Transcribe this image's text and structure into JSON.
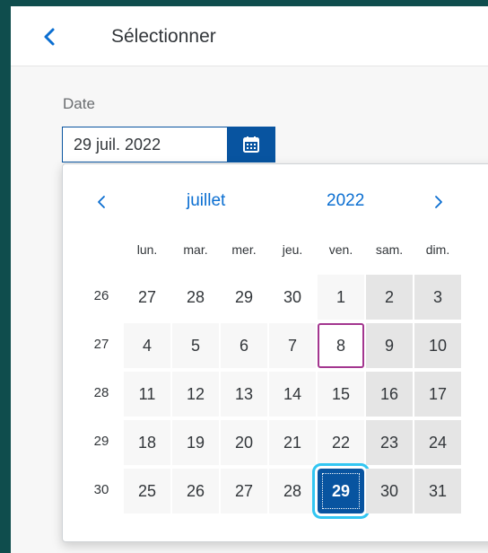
{
  "header": {
    "title": "Sélectionner",
    "back_icon": "chevron-left-icon"
  },
  "field": {
    "label": "Date",
    "value": "29 juil. 2022",
    "button_icon": "calendar-icon"
  },
  "calendar": {
    "month": "juillet",
    "year": "2022",
    "weekdays": [
      "lun.",
      "mar.",
      "mer.",
      "jeu.",
      "ven.",
      "sam.",
      "dim."
    ],
    "weeks": [
      {
        "number": "26",
        "days": [
          {
            "d": "27",
            "t": "other"
          },
          {
            "d": "28",
            "t": "other"
          },
          {
            "d": "29",
            "t": "other"
          },
          {
            "d": "30",
            "t": "other"
          },
          {
            "d": "1",
            "t": "cur"
          },
          {
            "d": "2",
            "t": "weekend"
          },
          {
            "d": "3",
            "t": "weekend"
          }
        ]
      },
      {
        "number": "27",
        "days": [
          {
            "d": "4",
            "t": "cur"
          },
          {
            "d": "5",
            "t": "cur"
          },
          {
            "d": "6",
            "t": "cur"
          },
          {
            "d": "7",
            "t": "cur"
          },
          {
            "d": "8",
            "t": "today"
          },
          {
            "d": "9",
            "t": "weekend"
          },
          {
            "d": "10",
            "t": "weekend"
          }
        ]
      },
      {
        "number": "28",
        "days": [
          {
            "d": "11",
            "t": "cur"
          },
          {
            "d": "12",
            "t": "cur"
          },
          {
            "d": "13",
            "t": "cur"
          },
          {
            "d": "14",
            "t": "cur"
          },
          {
            "d": "15",
            "t": "cur"
          },
          {
            "d": "16",
            "t": "weekend"
          },
          {
            "d": "17",
            "t": "weekend"
          }
        ]
      },
      {
        "number": "29",
        "days": [
          {
            "d": "18",
            "t": "cur"
          },
          {
            "d": "19",
            "t": "cur"
          },
          {
            "d": "20",
            "t": "cur"
          },
          {
            "d": "21",
            "t": "cur"
          },
          {
            "d": "22",
            "t": "cur"
          },
          {
            "d": "23",
            "t": "weekend"
          },
          {
            "d": "24",
            "t": "weekend"
          }
        ]
      },
      {
        "number": "30",
        "days": [
          {
            "d": "25",
            "t": "cur"
          },
          {
            "d": "26",
            "t": "cur"
          },
          {
            "d": "27",
            "t": "cur"
          },
          {
            "d": "28",
            "t": "cur"
          },
          {
            "d": "29",
            "t": "sel"
          },
          {
            "d": "30",
            "t": "weekend"
          },
          {
            "d": "31",
            "t": "weekend"
          }
        ]
      }
    ]
  },
  "colors": {
    "accent": "#0854a0",
    "link": "#0a6ed1",
    "today_border": "#a3368f",
    "focus": "#32c6f2",
    "frame": "#0f4d4d"
  }
}
